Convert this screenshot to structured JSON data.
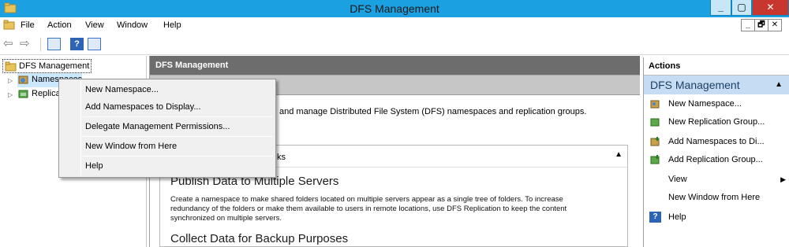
{
  "window": {
    "title": "DFS Management",
    "min": "_",
    "max": "▢",
    "close": "✕"
  },
  "menu": {
    "items": [
      "File",
      "Action",
      "View",
      "Window",
      "Help"
    ]
  },
  "mdi_buttons": {
    "min": "_",
    "restore": "🗗",
    "close": "✕"
  },
  "toolbar": {
    "back": "⇦",
    "forward": "⇨",
    "help": "?"
  },
  "tree": {
    "root": "DFS Management",
    "namespaces": "Namespaces",
    "replication": "Replication"
  },
  "center": {
    "header": "DFS Management",
    "overview": "and manage Distributed File System (DFS) namespaces and replication groups.",
    "tasks_heading": "ks",
    "section1_title": "Publish Data to Multiple Servers",
    "section1_body": "Create a namespace to make shared folders located on multiple servers appear as a single tree of folders. To increase redundancy of the folders or make them available to users in remote locations, use DFS Replication to keep the content synchronized on multiple servers.",
    "section2_title": "Collect Data for Backup Purposes"
  },
  "actions": {
    "header": "Actions",
    "section": "DFS Management",
    "items": [
      {
        "label": "New Namespace...",
        "icon": "namespace-icon"
      },
      {
        "label": "New Replication Group...",
        "icon": "replication-icon"
      },
      {
        "label": "Add Namespaces to Di...",
        "icon": "add-namespace-icon"
      },
      {
        "label": "Add Replication Group...",
        "icon": "add-replication-icon"
      },
      {
        "label": "View",
        "icon": ""
      },
      {
        "label": "New Window from Here",
        "icon": ""
      },
      {
        "label": "Help",
        "icon": "help-icon"
      }
    ]
  },
  "context_menu": {
    "items": [
      "New Namespace...",
      "Add Namespaces to Display...",
      "Delegate Management Permissions...",
      "New Window from Here",
      "Help"
    ]
  },
  "colors": {
    "titlebar": "#1ba1e2",
    "close": "#c7362f",
    "action_section": "#c6dcf2",
    "header": "#6d6d6d"
  }
}
